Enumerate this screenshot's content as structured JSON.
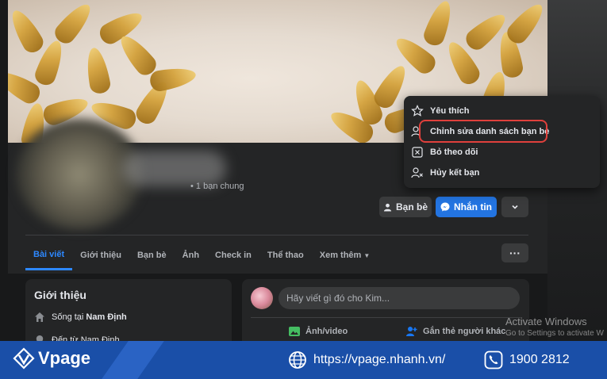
{
  "profile": {
    "mutual_friends": "1 bạn chung",
    "buttons": {
      "friends": "Bạn bè",
      "message": "Nhắn tin"
    }
  },
  "tabs": [
    {
      "label": "Bài viết"
    },
    {
      "label": "Giới thiệu"
    },
    {
      "label": "Bạn bè"
    },
    {
      "label": "Ảnh"
    },
    {
      "label": "Check in"
    },
    {
      "label": "Thể thao"
    },
    {
      "label": "Xem thêm"
    }
  ],
  "dropdown": {
    "items": [
      {
        "label": "Yêu thích",
        "icon": "star-icon"
      },
      {
        "label": "Chỉnh sửa danh sách bạn bè",
        "icon": "person-list-icon"
      },
      {
        "label": "Bỏ theo dõi",
        "icon": "unfollow-icon"
      },
      {
        "label": "Hủy kết bạn",
        "icon": "unfriend-icon"
      }
    ]
  },
  "intro": {
    "title": "Giới thiệu",
    "lives_prefix": "Sống tại ",
    "lives_place": "Nam Định",
    "from_partial": "Đến từ Nam Định"
  },
  "composer": {
    "placeholder": "Hãy viết gì đó cho Kim...",
    "photo_video": "Ảnh/video",
    "tag_people": "Gắn thẻ người khác"
  },
  "watermark": {
    "line1": "Activate Windows",
    "line2": "Go to Settings to activate W"
  },
  "footer": {
    "brand": "Vpage",
    "url": "https://vpage.nhanh.vn/",
    "phone": "1900 2812"
  },
  "colors": {
    "accent": "#2d88ff",
    "message_button": "#2374e1",
    "highlight": "#e0403c",
    "footer": "#1a4fa8"
  }
}
